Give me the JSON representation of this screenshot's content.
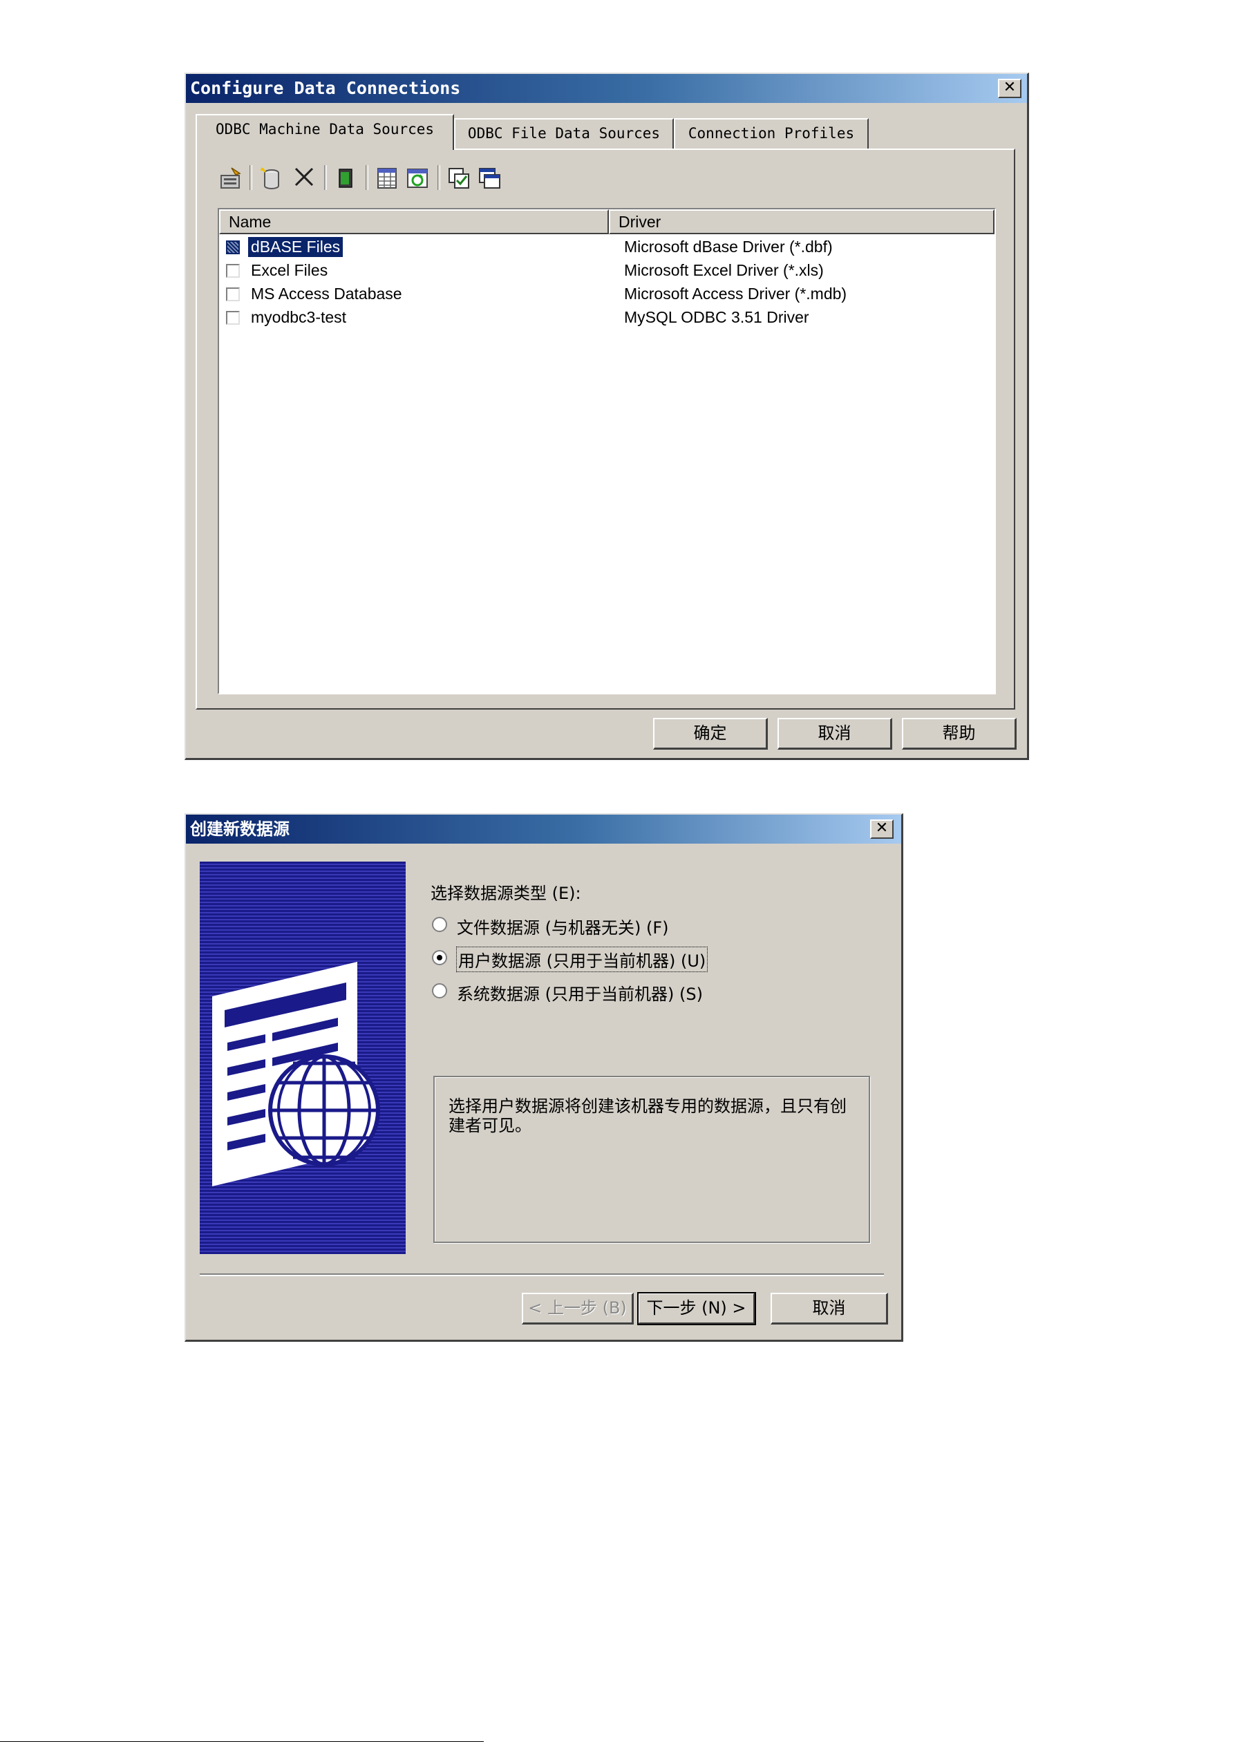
{
  "config_dialog": {
    "title": "Configure Data Connections",
    "close_symbol": "✕",
    "tabs": [
      {
        "label": "ODBC Machine Data Sources",
        "active": true
      },
      {
        "label": "ODBC File Data Sources",
        "active": false
      },
      {
        "label": "Connection Profiles",
        "active": false
      }
    ],
    "toolbar_icons": [
      "properties-icon",
      "new-database-icon",
      "delete-icon",
      "odbc-admin-icon",
      "grid-icon",
      "refresh-icon",
      "copy-icon",
      "window-icon"
    ],
    "columns": [
      "Name",
      "Driver"
    ],
    "rows": [
      {
        "name": "dBASE Files",
        "driver": "Microsoft dBase Driver (*.dbf)",
        "selected": true
      },
      {
        "name": "Excel Files",
        "driver": "Microsoft Excel Driver (*.xls)",
        "selected": false
      },
      {
        "name": "MS Access Database",
        "driver": "Microsoft Access Driver (*.mdb)",
        "selected": false
      },
      {
        "name": "myodbc3-test",
        "driver": "MySQL ODBC 3.51 Driver",
        "selected": false
      }
    ],
    "buttons": {
      "ok": "确定",
      "cancel": "取消",
      "help": "帮助"
    }
  },
  "new_ds_dialog": {
    "title": "创建新数据源",
    "close_symbol": "✕",
    "prompt": "选择数据源类型 (E):",
    "options": [
      {
        "label": "文件数据源 (与机器无关) (F)",
        "selected": false
      },
      {
        "label": "用户数据源 (只用于当前机器) (U)",
        "selected": true
      },
      {
        "label": "系统数据源 (只用于当前机器) (S)",
        "selected": false
      }
    ],
    "description": "选择用户数据源将创建该机器专用的数据源，且只有创建者可见。",
    "buttons": {
      "back": "< 上一步 (B)",
      "next": "下一步 (N) >",
      "cancel": "取消"
    }
  }
}
